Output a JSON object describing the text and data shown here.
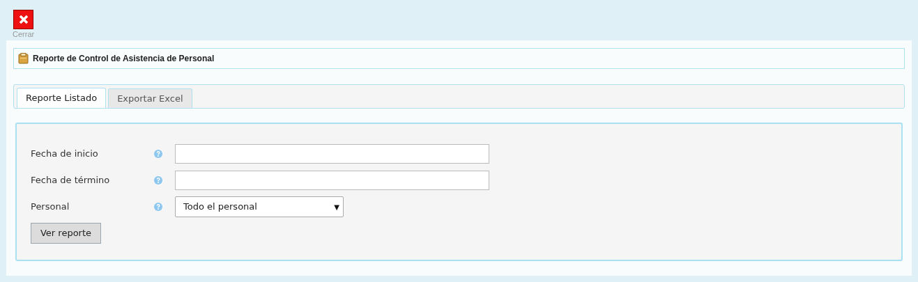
{
  "close_button": {
    "label": "Cerrar"
  },
  "panel": {
    "title": "Reporte de Control de Asistencia de Personal"
  },
  "tabs": [
    {
      "label": "Reporte Listado",
      "selected": true
    },
    {
      "label": "Exportar Excel",
      "selected": false
    }
  ],
  "form": {
    "fields": [
      {
        "kind": "text",
        "label": "Fecha de inicio"
      },
      {
        "kind": "text",
        "label": "Fecha de término"
      },
      {
        "kind": "select",
        "label": "Personal",
        "value": "Todo el personal",
        "arrow": "▼"
      }
    ],
    "submit": "Ver reporte"
  }
}
